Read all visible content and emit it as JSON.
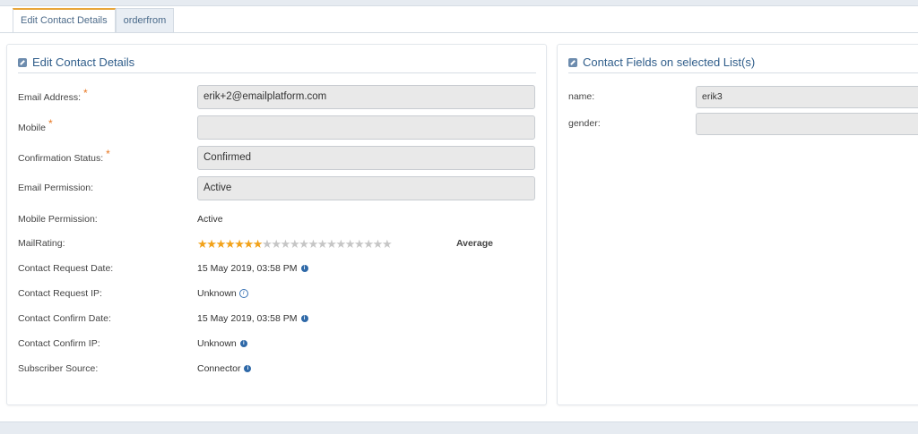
{
  "tabs": [
    {
      "label": "Edit Contact Details",
      "active": true
    },
    {
      "label": "orderfrom",
      "active": false
    }
  ],
  "left_panel": {
    "title": "Edit Contact Details",
    "fields": {
      "email": {
        "label": "Email Address:",
        "value": "erik+2@emailplatform.com",
        "required": true
      },
      "mobile": {
        "label": "Mobile",
        "value": "",
        "required": true
      },
      "confirmation": {
        "label": "Confirmation Status:",
        "value": "Confirmed",
        "required": true
      },
      "email_permission": {
        "label": "Email Permission:",
        "value": "Active"
      },
      "mobile_permission": {
        "label": "Mobile Permission:",
        "value": "Active"
      },
      "mail_rating": {
        "label": "MailRating:",
        "stars_filled": 7,
        "stars_total": 21,
        "text": "Average"
      },
      "request_date": {
        "label": "Contact Request Date:",
        "value": "15 May 2019, 03:58 PM"
      },
      "request_ip": {
        "label": "Contact Request IP:",
        "value": "Unknown"
      },
      "confirm_date": {
        "label": "Contact Confirm Date:",
        "value": "15 May 2019, 03:58 PM"
      },
      "confirm_ip": {
        "label": "Contact Confirm IP:",
        "value": "Unknown"
      },
      "source": {
        "label": "Subscriber Source:",
        "value": "Connector"
      }
    }
  },
  "right_panel": {
    "title": "Contact Fields on selected List(s)",
    "fields": {
      "name": {
        "label": "name:",
        "value": "erik3"
      },
      "gender": {
        "label": "gender:",
        "value": ""
      }
    }
  },
  "colors": {
    "accent": "#e8a63a",
    "title": "#2f5d8a",
    "star_on": "#f2a21a",
    "star_off": "#c6c6c6",
    "required": "#e87722"
  },
  "icons": {
    "required": "*",
    "panel": "edit-icon",
    "info": "info-icon"
  }
}
